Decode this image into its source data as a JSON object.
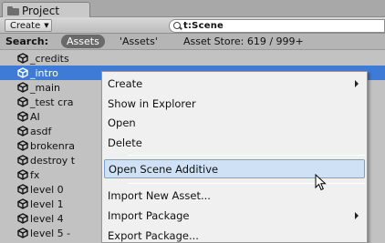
{
  "panel": {
    "tab_title": "Project"
  },
  "toolbar": {
    "create_label": "Create",
    "search_value": "t:Scene"
  },
  "search_bar": {
    "label": "Search:",
    "scope_active": "Assets",
    "scope_quoted": "'Assets'",
    "asset_store": "Asset Store: 619 / 999+"
  },
  "assets": [
    {
      "label": "_credits"
    },
    {
      "label": "_intro",
      "selected": true
    },
    {
      "label": "_main"
    },
    {
      "label": "_test cra"
    },
    {
      "label": "AI"
    },
    {
      "label": "asdf"
    },
    {
      "label": "brokenra"
    },
    {
      "label": "destroy t"
    },
    {
      "label": "fx"
    },
    {
      "label": "level 0"
    },
    {
      "label": "level 1"
    },
    {
      "label": "level 4"
    },
    {
      "label": "level 5 -"
    }
  ],
  "context_menu": {
    "items": [
      {
        "label": "Create",
        "submenu": true
      },
      {
        "label": "Show in Explorer"
      },
      {
        "label": "Open"
      },
      {
        "label": "Delete"
      },
      {
        "label": "Open Scene Additive",
        "highlighted": true
      },
      {
        "label": "Import New Asset..."
      },
      {
        "label": "Import Package",
        "submenu": true
      },
      {
        "label": "Export Package..."
      }
    ]
  },
  "icons": {
    "asset_icon": "unity-scene-icon",
    "tab_icon": "folder-icon",
    "search_icon": "magnifier-icon",
    "cursor": "mouse-pointer-icon"
  },
  "colors": {
    "selection": "#3e7bd6",
    "menu_highlight": "#cfe1f4",
    "menu_highlight_border": "#7da2ce"
  }
}
